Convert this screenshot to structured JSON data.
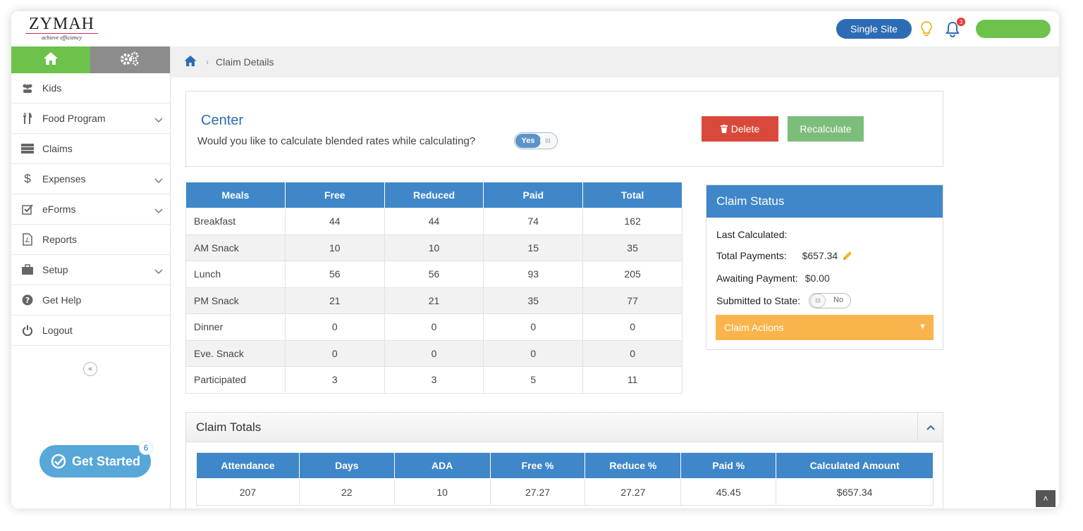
{
  "header": {
    "logo_text": "ZYMAH",
    "logo_tagline": "achieve efficiency",
    "site_button": "Single Site",
    "notification_count": "3",
    "colors": {
      "brand_blue": "#2d6cb5",
      "green": "#6cc24a"
    }
  },
  "sidebar": {
    "items": [
      {
        "label": "Kids",
        "icon": "users-icon",
        "has_submenu": false
      },
      {
        "label": "Food Program",
        "icon": "fork-knife-icon",
        "has_submenu": true
      },
      {
        "label": "Claims",
        "icon": "claims-icon",
        "has_submenu": false
      },
      {
        "label": "Expenses",
        "icon": "dollar-icon",
        "has_submenu": true
      },
      {
        "label": "eForms",
        "icon": "checkbox-icon",
        "has_submenu": true
      },
      {
        "label": "Reports",
        "icon": "pdf-icon",
        "has_submenu": false
      },
      {
        "label": "Setup",
        "icon": "briefcase-icon",
        "has_submenu": true
      },
      {
        "label": "Get Help",
        "icon": "question-icon",
        "has_submenu": false
      },
      {
        "label": "Logout",
        "icon": "power-icon",
        "has_submenu": false
      }
    ],
    "collapse_label": "«",
    "get_started_label": "Get Started",
    "get_started_count": "6"
  },
  "breadcrumb": {
    "current": "Claim Details"
  },
  "center": {
    "title": "Center",
    "question": "Would you like to calculate blended rates while calculating?",
    "toggle_label": "Yes",
    "toggle_knob": "III",
    "delete_label": "Delete",
    "recalculate_label": "Recalculate"
  },
  "meals_table": {
    "headers": [
      "Meals",
      "Free",
      "Reduced",
      "Paid",
      "Total"
    ],
    "rows": [
      [
        "Breakfast",
        "44",
        "44",
        "74",
        "162"
      ],
      [
        "AM Snack",
        "10",
        "10",
        "15",
        "35"
      ],
      [
        "Lunch",
        "56",
        "56",
        "93",
        "205"
      ],
      [
        "PM Snack",
        "21",
        "21",
        "35",
        "77"
      ],
      [
        "Dinner",
        "0",
        "0",
        "0",
        "0"
      ],
      [
        "Eve. Snack",
        "0",
        "0",
        "0",
        "0"
      ],
      [
        "Participated",
        "3",
        "3",
        "5",
        "11"
      ]
    ]
  },
  "claim_status": {
    "title": "Claim Status",
    "last_calculated_label": "Last Calculated:",
    "total_payments_label": "Total Payments:",
    "total_payments_value": "$657.34",
    "awaiting_label": "Awaiting Payment:",
    "awaiting_value": "$0.00",
    "submitted_label": "Submitted to State:",
    "submitted_toggle": "No",
    "submitted_knob": "III",
    "actions_label": "Claim Actions"
  },
  "claim_totals": {
    "title": "Claim Totals",
    "headers": [
      "Attendance",
      "Days",
      "ADA",
      "Free %",
      "Reduce %",
      "Paid %",
      "Calculated Amount"
    ],
    "rows": [
      [
        "207",
        "22",
        "10",
        "27.27",
        "27.27",
        "45.45",
        "$657.34"
      ]
    ]
  }
}
